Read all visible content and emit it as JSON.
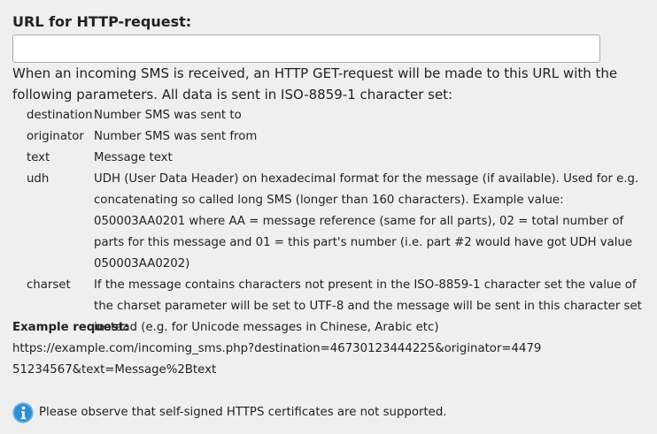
{
  "url_field": {
    "label": "URL for HTTP-request:",
    "value": "",
    "placeholder": ""
  },
  "description": "When an incoming SMS is received, an HTTP GET-request will be made to this URL with the following parameters. All data is sent in ISO-8859-1 character set:",
  "parameters": [
    {
      "name": "destination",
      "desc": "Number SMS was sent to"
    },
    {
      "name": "originator",
      "desc": "Number SMS was sent from"
    },
    {
      "name": "text",
      "desc": "Message text"
    },
    {
      "name": "udh",
      "desc": "UDH (User Data Header) on hexadecimal format for the message (if available). Used for e.g. concatenating so called long SMS (longer than 160 characters). Example value: 050003AA0201 where AA = message reference (same for all parts), 02 = total number of parts for this message and 01 = this part's number (i.e. part #2 would have got UDH value 050003AA0202)"
    },
    {
      "name": "charset",
      "desc": "If the message contains characters not present in the ISO-8859-1 character set the value of the charset parameter will be set to UTF-8 and the message will be sent in this character set instead (e.g. for Unicode messages in Chinese, Arabic etc)"
    }
  ],
  "example": {
    "label": "Example request:",
    "url": "https://example.com/incoming_sms.php?destination=46730123444225&originator=447951234567&text=Message%2Btext"
  },
  "notice": {
    "icon": "info-icon",
    "text": "Please observe that self-signed HTTPS certificates are not supported."
  },
  "colors": {
    "background": "#efefef",
    "info_icon": "#2a8fd6"
  }
}
